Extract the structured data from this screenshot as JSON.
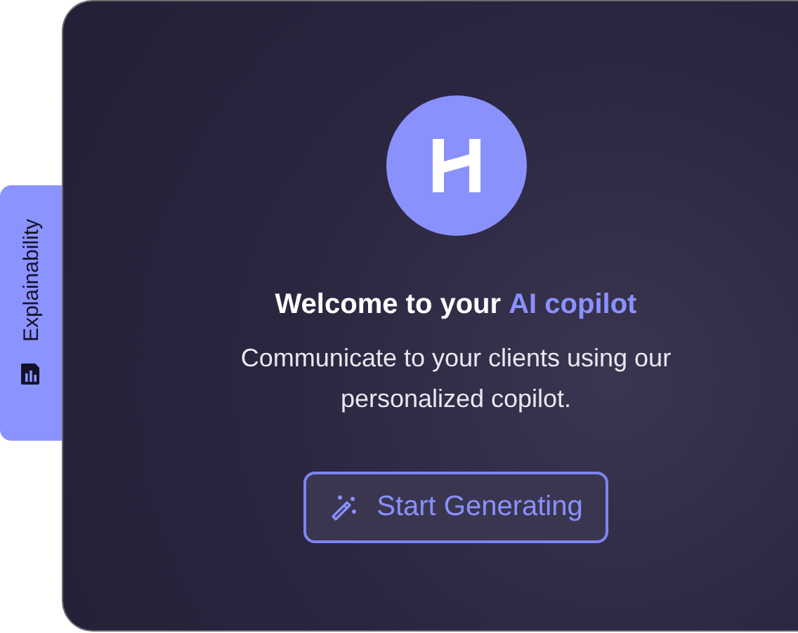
{
  "side_tab": {
    "label": "Explainability"
  },
  "welcome": {
    "title": "Welcome to your **AI copilot**",
    "subtitle": "Communicate to your clients using our personalized copilot."
  },
  "button": {
    "label": "Start Generating"
  }
}
